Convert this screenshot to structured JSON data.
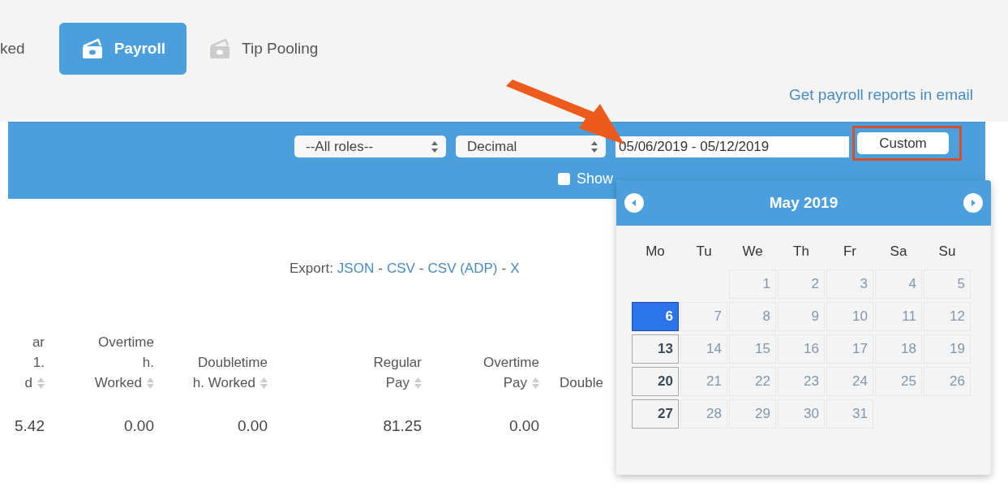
{
  "tabs": [
    {
      "label": "ked",
      "selected": false,
      "icon": false
    },
    {
      "label": "Payroll",
      "selected": true,
      "icon": true
    },
    {
      "label": "Tip Pooling",
      "selected": false,
      "icon": true
    }
  ],
  "email_link": "Get payroll reports in email",
  "filters": {
    "role_select": "--All roles--",
    "format_select": "Decimal",
    "date_range": "05/06/2019 - 05/12/2019",
    "custom_button": "Custom",
    "show_checkbox": {
      "label": "Show",
      "checked": false
    }
  },
  "export": {
    "label": "Export:",
    "links": [
      "JSON",
      "CSV",
      "CSV (ADP)",
      "X"
    ],
    "separator": "-"
  },
  "table": {
    "columns": [
      {
        "lines": [
          "ar",
          "1.",
          "d"
        ],
        "sortable": true
      },
      {
        "lines": [
          "Overtime",
          "h.",
          "Worked"
        ],
        "sortable": true
      },
      {
        "lines": [
          "Doubletime",
          "h. Worked"
        ],
        "sortable": true
      },
      {
        "lines": [
          "Regular",
          "Pay"
        ],
        "sortable": true
      },
      {
        "lines": [
          "Overtime",
          "Pay"
        ],
        "sortable": true
      },
      {
        "lines": [
          "Double"
        ]
      }
    ],
    "rows": [
      [
        "5.42",
        "0.00",
        "0.00",
        "81.25",
        "0.00"
      ]
    ]
  },
  "calendar": {
    "title": "May 2019",
    "weekdays": [
      "Mo",
      "Tu",
      "We",
      "Th",
      "Fr",
      "Sa",
      "Su"
    ],
    "days": [
      {
        "kind": "blank"
      },
      {
        "kind": "blank"
      },
      {
        "kind": "day",
        "label": "1",
        "disabled": true,
        "selected": false
      },
      {
        "kind": "day",
        "label": "2",
        "disabled": true,
        "selected": false
      },
      {
        "kind": "day",
        "label": "3",
        "disabled": true,
        "selected": false
      },
      {
        "kind": "day",
        "label": "4",
        "disabled": true,
        "selected": false
      },
      {
        "kind": "day",
        "label": "5",
        "disabled": true,
        "selected": false
      },
      {
        "kind": "day",
        "label": "6",
        "disabled": false,
        "selected": true
      },
      {
        "kind": "day",
        "label": "7",
        "disabled": true,
        "selected": false
      },
      {
        "kind": "day",
        "label": "8",
        "disabled": true,
        "selected": false
      },
      {
        "kind": "day",
        "label": "9",
        "disabled": true,
        "selected": false
      },
      {
        "kind": "day",
        "label": "10",
        "disabled": true,
        "selected": false
      },
      {
        "kind": "day",
        "label": "11",
        "disabled": true,
        "selected": false
      },
      {
        "kind": "day",
        "label": "12",
        "disabled": true,
        "selected": false
      },
      {
        "kind": "day",
        "label": "13",
        "disabled": false,
        "selected": false
      },
      {
        "kind": "day",
        "label": "14",
        "disabled": true,
        "selected": false
      },
      {
        "kind": "day",
        "label": "15",
        "disabled": true,
        "selected": false
      },
      {
        "kind": "day",
        "label": "16",
        "disabled": true,
        "selected": false
      },
      {
        "kind": "day",
        "label": "17",
        "disabled": true,
        "selected": false
      },
      {
        "kind": "day",
        "label": "18",
        "disabled": true,
        "selected": false
      },
      {
        "kind": "day",
        "label": "19",
        "disabled": true,
        "selected": false
      },
      {
        "kind": "day",
        "label": "20",
        "disabled": false,
        "selected": false
      },
      {
        "kind": "day",
        "label": "21",
        "disabled": true,
        "selected": false
      },
      {
        "kind": "day",
        "label": "22",
        "disabled": true,
        "selected": false
      },
      {
        "kind": "day",
        "label": "23",
        "disabled": true,
        "selected": false
      },
      {
        "kind": "day",
        "label": "24",
        "disabled": true,
        "selected": false
      },
      {
        "kind": "day",
        "label": "25",
        "disabled": true,
        "selected": false
      },
      {
        "kind": "day",
        "label": "26",
        "disabled": true,
        "selected": false
      },
      {
        "kind": "day",
        "label": "27",
        "disabled": false,
        "selected": false
      },
      {
        "kind": "day",
        "label": "28",
        "disabled": true,
        "selected": false
      },
      {
        "kind": "day",
        "label": "29",
        "disabled": true,
        "selected": false
      },
      {
        "kind": "day",
        "label": "30",
        "disabled": true,
        "selected": false
      },
      {
        "kind": "day",
        "label": "31",
        "disabled": true,
        "selected": false
      }
    ]
  }
}
